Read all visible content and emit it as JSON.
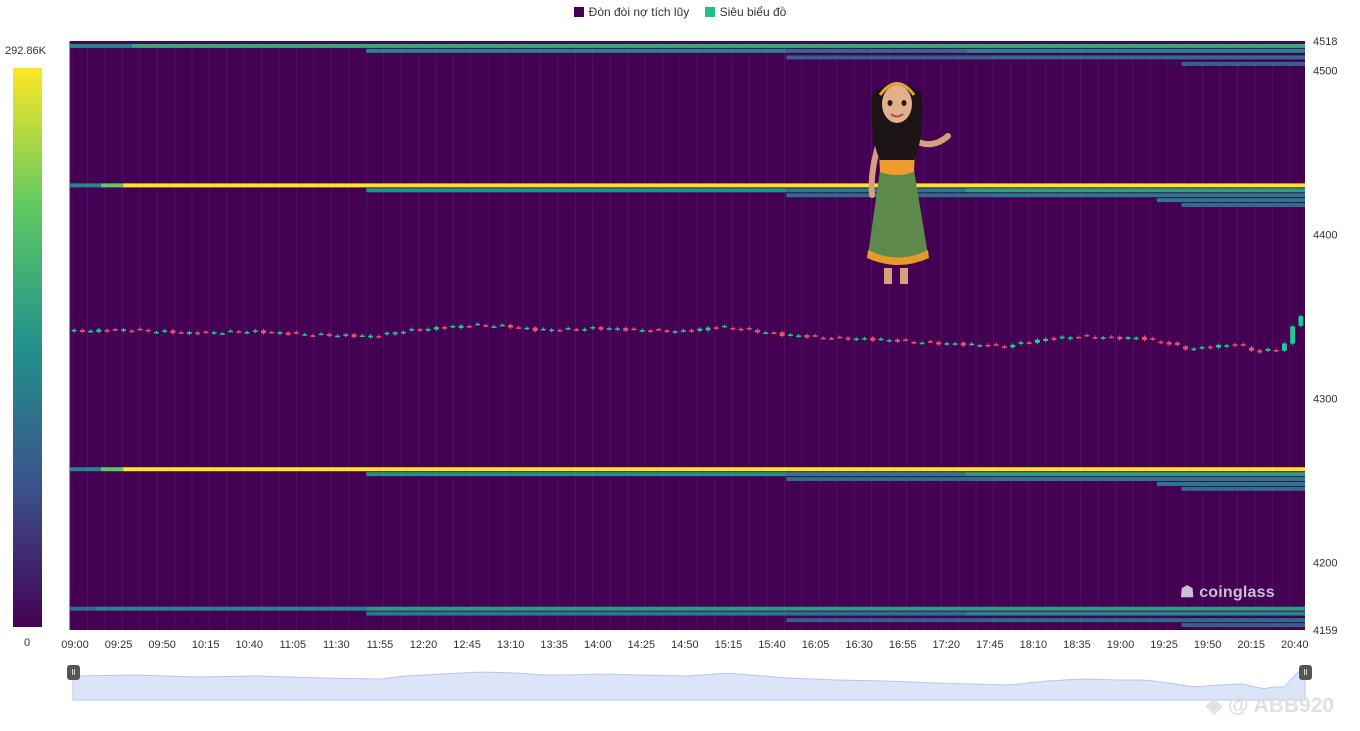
{
  "legend": [
    {
      "label": "Đòn đòi nợ tích lũy",
      "color": "#440154"
    },
    {
      "label": "Siêu biểu đồ",
      "color": "#20c080"
    }
  ],
  "colorscale": {
    "max_label": "292.86K",
    "min_label": "0",
    "stops": [
      "#440154",
      "#3b528b",
      "#21918c",
      "#5ec962",
      "#fde725"
    ]
  },
  "watermark": {
    "logo": "coinglass",
    "user": "@ ABB920"
  },
  "colors": {
    "background": "#440154",
    "up": "#20c997",
    "down": "#f0506e",
    "navigator_fill": "#dce4f8",
    "navigator_line": "#b8c6f0"
  },
  "chart_data": {
    "type": "heatmap",
    "title": "",
    "x_ticks": [
      "09:00",
      "09:25",
      "09:50",
      "10:15",
      "10:40",
      "11:05",
      "11:30",
      "11:55",
      "12:20",
      "12:45",
      "13:10",
      "13:35",
      "14:00",
      "14:25",
      "14:50",
      "15:15",
      "15:40",
      "16:05",
      "16:30",
      "16:55",
      "17:20",
      "17:45",
      "18:10",
      "18:35",
      "19:00",
      "19:25",
      "19:50",
      "20:15",
      "20:40"
    ],
    "y_ticks": [
      4518,
      4500,
      4400,
      4300,
      4200,
      4159
    ],
    "ylim": [
      4159,
      4518
    ],
    "x_range": [
      "09:00",
      "20:55"
    ],
    "liquidation_bands": [
      {
        "price": 4515,
        "levels": [
          [
            0,
            0.45
          ],
          [
            0.05,
            0.6
          ],
          [
            0.24,
            0.6
          ]
        ]
      },
      {
        "price": 4512,
        "levels": [
          [
            0.24,
            0.45
          ],
          [
            0.58,
            0.35
          ],
          [
            0.725,
            0.45
          ]
        ]
      },
      {
        "price": 4508,
        "levels": [
          [
            0.58,
            0.3
          ],
          [
            0.745,
            0.35
          ]
        ]
      },
      {
        "price": 4504,
        "levels": [
          [
            0.9,
            0.3
          ]
        ]
      },
      {
        "price": 4430,
        "levels": [
          [
            0,
            0.45
          ],
          [
            0.025,
            0.75
          ],
          [
            0.043,
            1.0
          ]
        ]
      },
      {
        "price": 4427,
        "levels": [
          [
            0.24,
            0.5
          ],
          [
            0.58,
            0.4
          ],
          [
            0.725,
            0.55
          ]
        ]
      },
      {
        "price": 4424,
        "levels": [
          [
            0.58,
            0.35
          ],
          [
            0.745,
            0.4
          ]
        ]
      },
      {
        "price": 4421,
        "levels": [
          [
            0.88,
            0.4
          ]
        ]
      },
      {
        "price": 4418,
        "levels": [
          [
            0.9,
            0.35
          ]
        ]
      },
      {
        "price": 4257,
        "levels": [
          [
            0,
            0.45
          ],
          [
            0.025,
            0.75
          ],
          [
            0.043,
            1.0
          ]
        ]
      },
      {
        "price": 4254,
        "levels": [
          [
            0.24,
            0.5
          ],
          [
            0.58,
            0.4
          ],
          [
            0.725,
            0.55
          ]
        ]
      },
      {
        "price": 4251,
        "levels": [
          [
            0.58,
            0.35
          ],
          [
            0.745,
            0.4
          ]
        ]
      },
      {
        "price": 4248,
        "levels": [
          [
            0.88,
            0.4
          ]
        ]
      },
      {
        "price": 4245,
        "levels": [
          [
            0.9,
            0.35
          ]
        ]
      },
      {
        "price": 4172,
        "levels": [
          [
            0,
            0.35
          ],
          [
            0.02,
            0.45
          ],
          [
            0.24,
            0.55
          ]
        ]
      },
      {
        "price": 4169,
        "levels": [
          [
            0.24,
            0.4
          ],
          [
            0.58,
            0.35
          ],
          [
            0.725,
            0.45
          ]
        ]
      },
      {
        "price": 4165,
        "levels": [
          [
            0.58,
            0.3
          ],
          [
            0.745,
            0.35
          ]
        ]
      },
      {
        "price": 4162,
        "levels": [
          [
            0.9,
            0.3
          ]
        ]
      }
    ],
    "price_path": [
      [
        0,
        4341
      ],
      [
        0.05,
        4342
      ],
      [
        0.1,
        4340
      ],
      [
        0.15,
        4341
      ],
      [
        0.2,
        4339
      ],
      [
        0.25,
        4338
      ],
      [
        0.27,
        4341
      ],
      [
        0.3,
        4343
      ],
      [
        0.33,
        4345
      ],
      [
        0.36,
        4344
      ],
      [
        0.38,
        4342
      ],
      [
        0.4,
        4342
      ],
      [
        0.43,
        4343
      ],
      [
        0.46,
        4342
      ],
      [
        0.5,
        4341
      ],
      [
        0.53,
        4344
      ],
      [
        0.56,
        4341
      ],
      [
        0.58,
        4339
      ],
      [
        0.62,
        4337
      ],
      [
        0.66,
        4336
      ],
      [
        0.7,
        4334
      ],
      [
        0.73,
        4333
      ],
      [
        0.76,
        4332
      ],
      [
        0.79,
        4336
      ],
      [
        0.82,
        4338
      ],
      [
        0.85,
        4337
      ],
      [
        0.87,
        4337
      ],
      [
        0.89,
        4334
      ],
      [
        0.91,
        4330
      ],
      [
        0.93,
        4332
      ],
      [
        0.95,
        4333
      ],
      [
        0.965,
        4328
      ],
      [
        0.975,
        4330
      ],
      [
        0.985,
        4330
      ],
      [
        0.99,
        4340
      ],
      [
        1.0,
        4351
      ]
    ]
  }
}
